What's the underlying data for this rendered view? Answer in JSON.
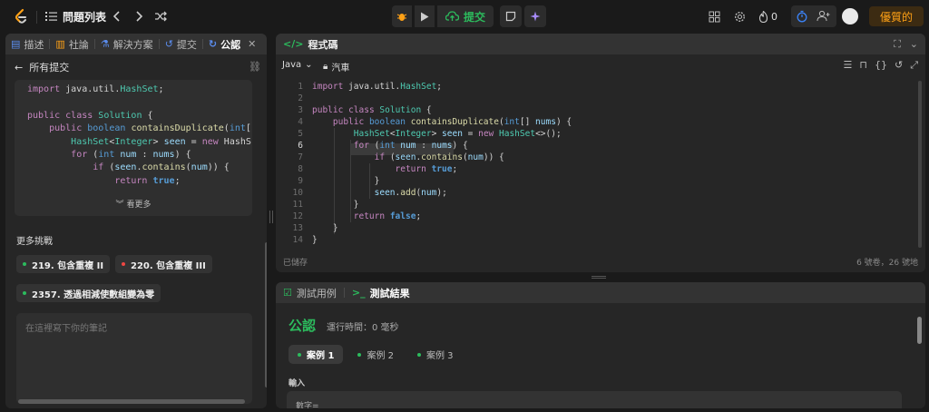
{
  "topbar": {
    "problem_list_label": "問題列表",
    "submit_label": "提交",
    "fire_count": "0",
    "premium_label": "優質的"
  },
  "left_panel": {
    "tabs": [
      {
        "label": "描述",
        "icon": "description-icon"
      },
      {
        "label": "社論",
        "icon": "book-icon"
      },
      {
        "label": "解決方案",
        "icon": "flask-icon"
      },
      {
        "label": "提交",
        "icon": "history-icon"
      },
      {
        "label": "公認",
        "icon": "accepted-icon",
        "active": true
      }
    ],
    "all_submissions_label": "所有提交",
    "see_more_label": "看更多",
    "more_challenges_title": "更多挑戰",
    "challenges": [
      {
        "label": "219. 包含重複 II",
        "color": "#2cbb5d"
      },
      {
        "label": "220. 包含重複 III",
        "color": "#ef4743"
      },
      {
        "label": "2357. 透過相減使數組變為零",
        "color": "#2cbb5d"
      }
    ],
    "notes_placeholder": "在這裡寫下你的筆記"
  },
  "code_panel": {
    "title": "程式碼",
    "language": "Java",
    "lock_label": "汽車",
    "status_saved": "已儲存",
    "cursor_position": "6 號卷，26 號地"
  },
  "editor": {
    "current_line": 6,
    "lines": [
      {
        "n": "1",
        "text": "import java.util.HashSet;"
      },
      {
        "n": "2",
        "text": ""
      },
      {
        "n": "3",
        "text": "public class Solution {"
      },
      {
        "n": "4",
        "text": "    public boolean containsDuplicate(int[] nums) {"
      },
      {
        "n": "5",
        "text": "        HashSet<Integer> seen = new HashSet<>();"
      },
      {
        "n": "6",
        "text": "        for (int num : nums) {"
      },
      {
        "n": "7",
        "text": "            if (seen.contains(num)) {"
      },
      {
        "n": "8",
        "text": "                return true;"
      },
      {
        "n": "9",
        "text": "            }"
      },
      {
        "n": "10",
        "text": "            seen.add(num);"
      },
      {
        "n": "11",
        "text": "        }"
      },
      {
        "n": "12",
        "text": "        return false;"
      },
      {
        "n": "13",
        "text": "    }"
      },
      {
        "n": "14",
        "text": "}"
      }
    ]
  },
  "submission_code": {
    "lines": [
      "import java.util.HashSet;",
      "",
      "public class Solution {",
      "    public boolean containsDuplicate(int[",
      "        HashSet<Integer> seen = new HashS",
      "        for (int num : nums) {",
      "            if (seen.contains(num)) {",
      "                return true;"
    ]
  },
  "result_panel": {
    "tab_testcase": "測試用例",
    "tab_result": "測試結果",
    "status": "公認",
    "runtime": "運行時間：0 毫秒",
    "cases": [
      "案例 1",
      "案例 2",
      "案例 3"
    ],
    "input_label": "輸入",
    "input_var": "數字="
  }
}
